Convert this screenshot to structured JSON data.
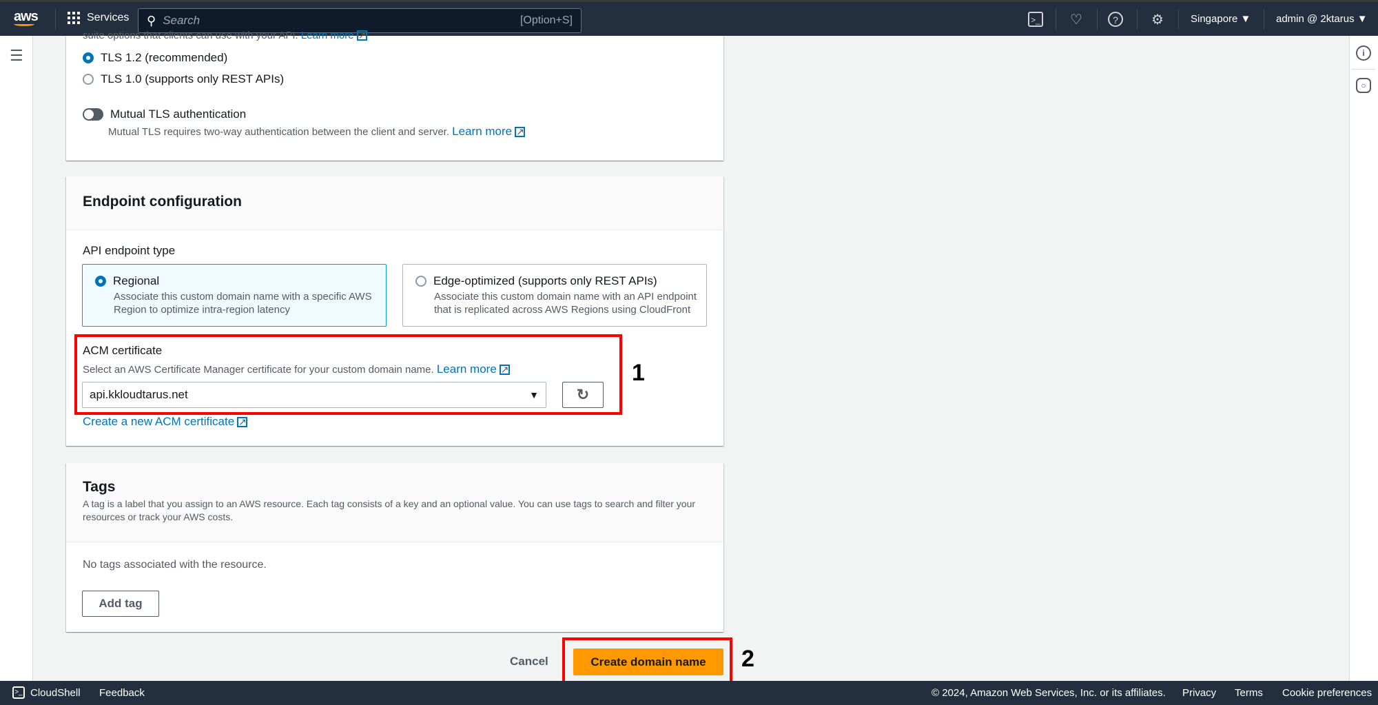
{
  "topnav": {
    "logo": "aws",
    "services": "Services",
    "search_placeholder": "Search",
    "search_shortcut": "[Option+S]",
    "region": "Singapore ▼",
    "user": "admin @ 2ktarus ▼"
  },
  "tls": {
    "intro_cut": "suite options that clients can use with your API.",
    "learn_more": "Learn more",
    "options": [
      {
        "label": "TLS 1.2 (recommended)",
        "selected": true
      },
      {
        "label": "TLS 1.0 (supports only REST APIs)",
        "selected": false
      }
    ],
    "mutual_label": "Mutual TLS authentication",
    "mutual_enabled": false,
    "mutual_desc": "Mutual TLS requires two-way authentication between the client and server.",
    "mutual_learn_more": "Learn more"
  },
  "endpoint": {
    "title": "Endpoint configuration",
    "type_label": "API endpoint type",
    "options": [
      {
        "label": "Regional",
        "desc": "Associate this custom domain name with a specific AWS Region to optimize intra-region latency",
        "selected": true
      },
      {
        "label": "Edge-optimized (supports only REST APIs)",
        "desc": "Associate this custom domain name with an API endpoint that is replicated across AWS Regions using CloudFront",
        "selected": false
      }
    ],
    "acm_label": "ACM certificate",
    "acm_desc": "Select an AWS Certificate Manager certificate for your custom domain name.",
    "acm_learn_more": "Learn more",
    "acm_value": "api.kkloudtarus.net",
    "create_acm": "Create a new ACM certificate"
  },
  "annotations": {
    "one": "1",
    "two": "2",
    "highlight_color": "#ff0000"
  },
  "tags": {
    "title": "Tags",
    "desc": "A tag is a label that you assign to an AWS resource. Each tag consists of a key and an optional value. You can use tags to search and filter your resources or track your AWS costs.",
    "empty": "No tags associated with the resource.",
    "add": "Add tag"
  },
  "actions": {
    "cancel": "Cancel",
    "create": "Create domain name",
    "primary_color": "#ff9900"
  },
  "footer": {
    "cloudshell": "CloudShell",
    "feedback": "Feedback",
    "copyright": "© 2024, Amazon Web Services, Inc. or its affiliates.",
    "privacy": "Privacy",
    "terms": "Terms",
    "cookies": "Cookie preferences"
  }
}
